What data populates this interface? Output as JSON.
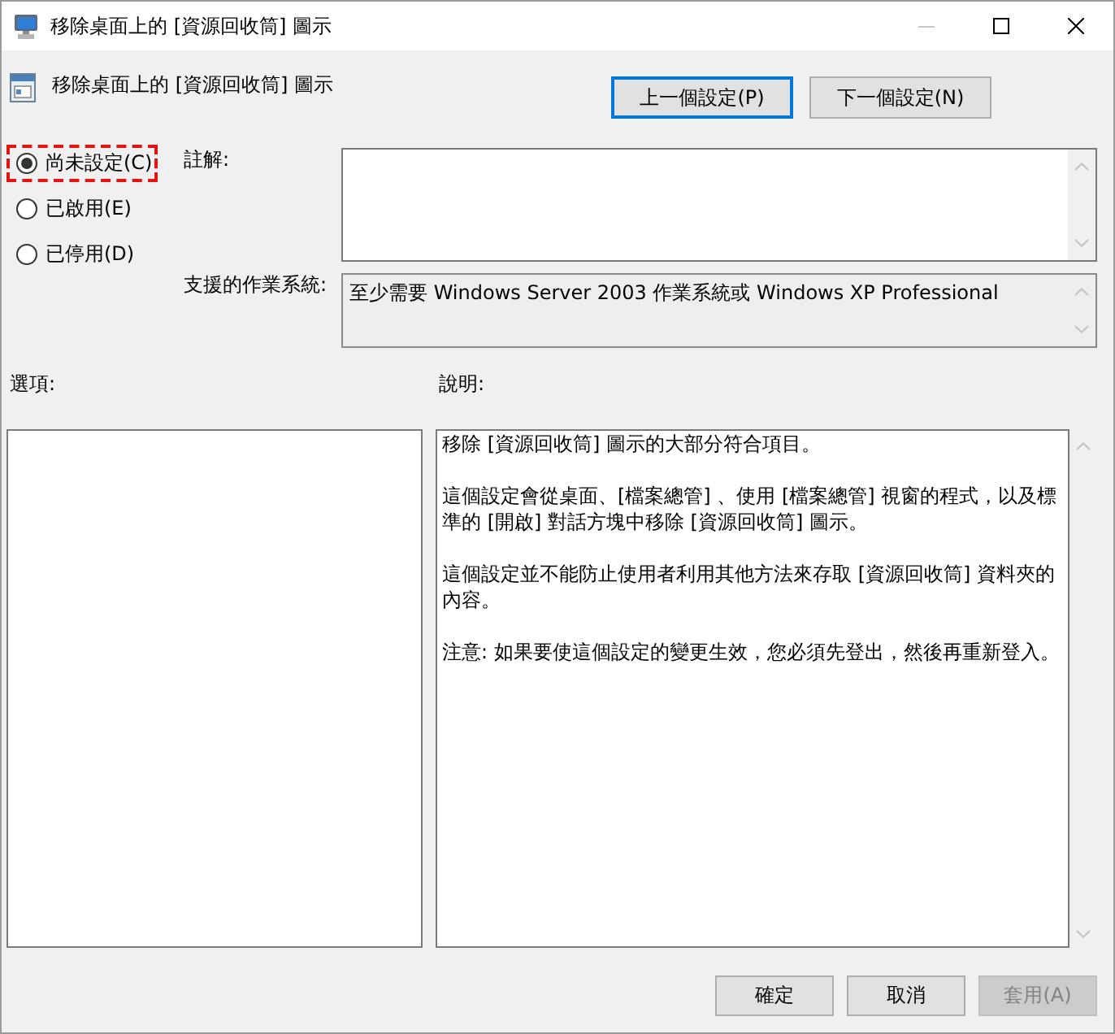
{
  "window": {
    "title": "移除桌面上的 [資源回收筒] 圖示",
    "minimize_disabled": true
  },
  "header": {
    "title": "移除桌面上的 [資源回收筒] 圖示",
    "buttons": [
      {
        "label": "上一個設定(P)",
        "focused": true
      },
      {
        "label": "下一個設定(N)",
        "focused": false
      }
    ]
  },
  "state_options": [
    {
      "label": "尚未設定(C)",
      "selected": true,
      "highlighted": true
    },
    {
      "label": "已啟用(E)",
      "selected": false,
      "highlighted": false
    },
    {
      "label": "已停用(D)",
      "selected": false,
      "highlighted": false
    }
  ],
  "comment": {
    "label": "註解:"
  },
  "supported_on": {
    "label": "支援的作業系統:",
    "value": "至少需要 Windows Server 2003 作業系統或 Windows XP Professional"
  },
  "options": {
    "label": "選項:"
  },
  "help": {
    "label": "說明:",
    "paragraphs": [
      "移除 [資源回收筒] 圖示的大部分符合項目。",
      "這個設定會從桌面、[檔案總管] 、使用 [檔案總管] 視窗的程式，以及標準的 [開啟] 對話方塊中移除 [資源回收筒] 圖示。",
      "這個設定並不能防止使用者利用其他方法來存取 [資源回收筒] 資料夾的內容。",
      "注意: 如果要使這個設定的變更生效，您必須先登出，然後再重新登入。"
    ]
  },
  "footer_buttons": [
    {
      "label": "確定",
      "disabled": false
    },
    {
      "label": "取消",
      "disabled": false
    },
    {
      "label": "套用(A)",
      "disabled": true
    }
  ]
}
